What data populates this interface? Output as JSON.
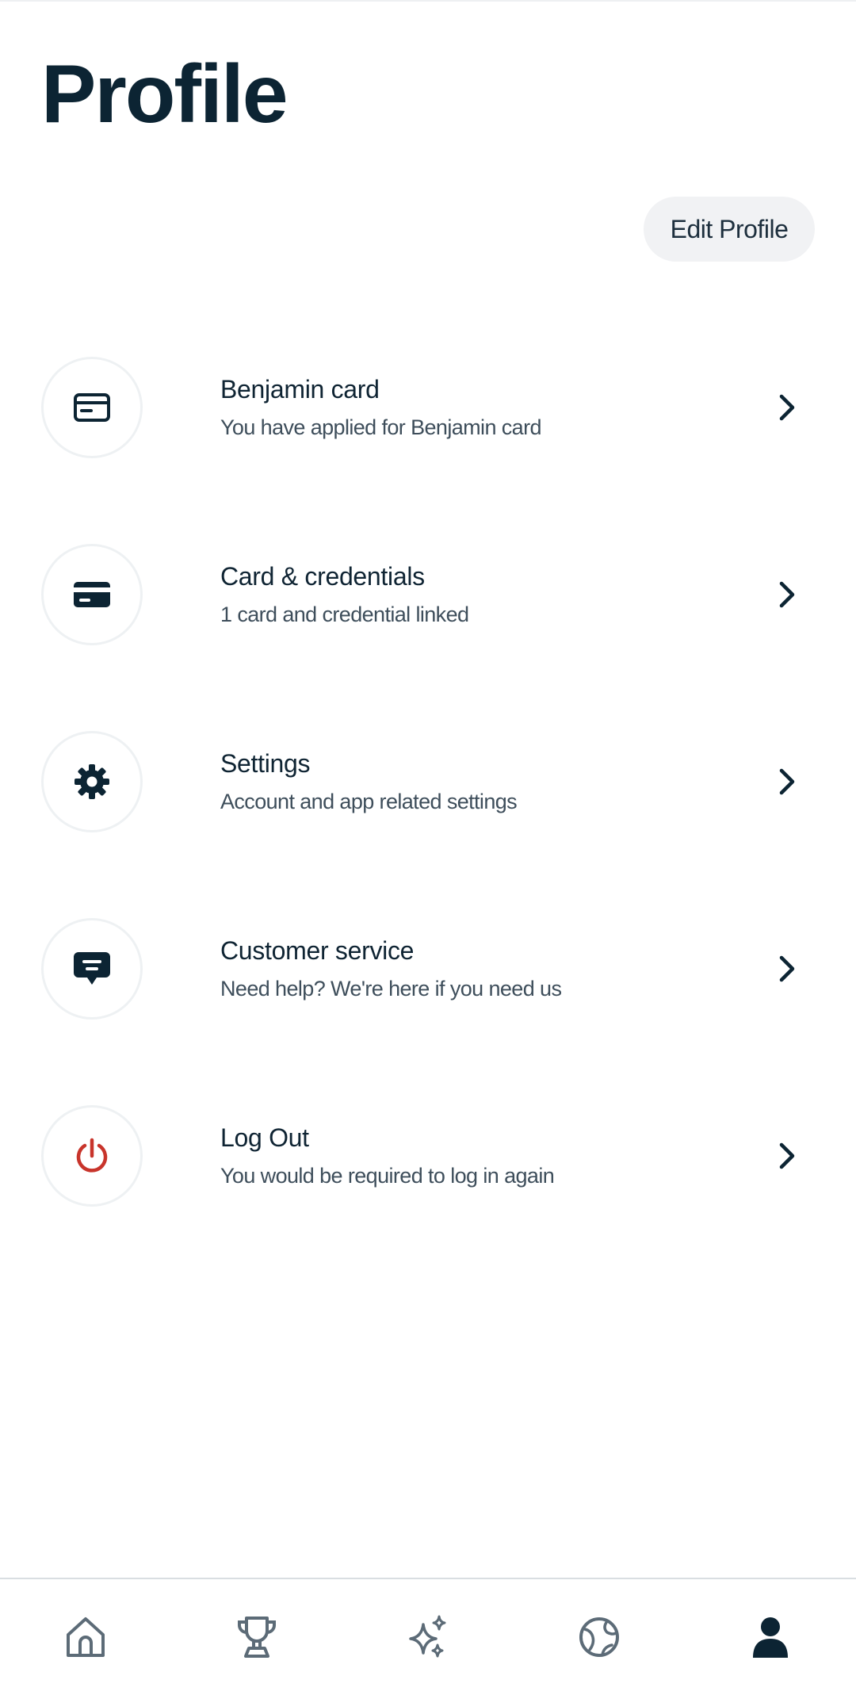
{
  "header": {
    "title": "Profile"
  },
  "user": {
    "name": "",
    "edit_label": "Edit Profile"
  },
  "menu": [
    {
      "icon": "card-outline-icon",
      "title": "Benjamin card",
      "subtitle": "You have applied for Benjamin card"
    },
    {
      "icon": "credit-card-icon",
      "title": "Card & credentials",
      "subtitle": "1 card and credential linked"
    },
    {
      "icon": "gear-icon",
      "title": "Settings",
      "subtitle": "Account and app related settings"
    },
    {
      "icon": "chat-bubble-icon",
      "title": "Customer service",
      "subtitle": "Need help? We're here if you need us"
    },
    {
      "icon": "power-icon",
      "title": "Log Out",
      "subtitle": "You would be required to log in again"
    }
  ],
  "bottom_nav": [
    {
      "icon": "home-icon"
    },
    {
      "icon": "trophy-icon"
    },
    {
      "icon": "sparkle-icon"
    },
    {
      "icon": "globe-icon"
    },
    {
      "icon": "profile-icon",
      "active": true
    }
  ],
  "colors": {
    "primary": "#0c2433",
    "logout": "#c8342b",
    "muted_icon": "#5c6b77",
    "button_bg": "#f1f2f4"
  }
}
